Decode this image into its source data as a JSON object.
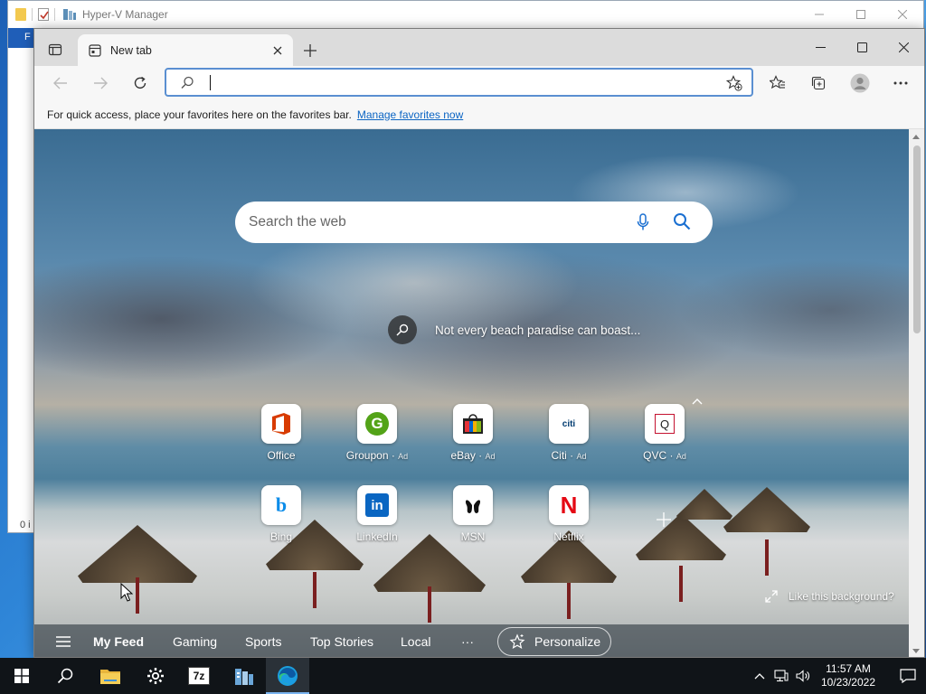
{
  "background_window": {
    "title": "Hyper-V Manager",
    "ribbon_letter": "F",
    "status_fragment": "0 i",
    "controls": [
      "minimize-icon",
      "maximize-icon",
      "close-icon"
    ]
  },
  "edge": {
    "tab": {
      "label": "New tab"
    },
    "address_bar": {
      "value": "",
      "placeholder": ""
    },
    "favorites_bar": {
      "message": "For quick access, place your favorites here on the favorites bar.",
      "link": "Manage favorites now"
    },
    "new_tab_page": {
      "search_placeholder": "Search the web",
      "image_caption": "Not every beach paradise can boast...",
      "like_background": "Like this background?",
      "quick_links": [
        {
          "label": "Office",
          "ad": ""
        },
        {
          "label": "Groupon",
          "ad": "Ad"
        },
        {
          "label": "eBay",
          "ad": "Ad"
        },
        {
          "label": "Citi",
          "ad": "Ad"
        },
        {
          "label": "QVC",
          "ad": "Ad"
        },
        {
          "label": "Bing",
          "ad": ""
        },
        {
          "label": "LinkedIn",
          "ad": ""
        },
        {
          "label": "MSN",
          "ad": ""
        },
        {
          "label": "Netflix",
          "ad": ""
        }
      ],
      "icon_text": {
        "groupon": "G",
        "citi": "citi",
        "qvc": "Q",
        "bing": "b",
        "linkedin": "in",
        "netflix": "N"
      },
      "feed_nav": {
        "items": [
          "My Feed",
          "Gaming",
          "Sports",
          "Top Stories",
          "Local",
          "···"
        ],
        "personalize": "Personalize"
      }
    }
  },
  "taskbar": {
    "clock_time": "11:57 AM",
    "clock_date": "10/23/2022",
    "sevenzip_label": "7z"
  },
  "colors": {
    "accent": "#0b64c3",
    "address_border": "#5a8fd1",
    "taskbar": "#101418",
    "netflix": "#e50914",
    "groupon": "#53a318",
    "linkedin": "#0a66c2",
    "office": "#d83b01"
  }
}
